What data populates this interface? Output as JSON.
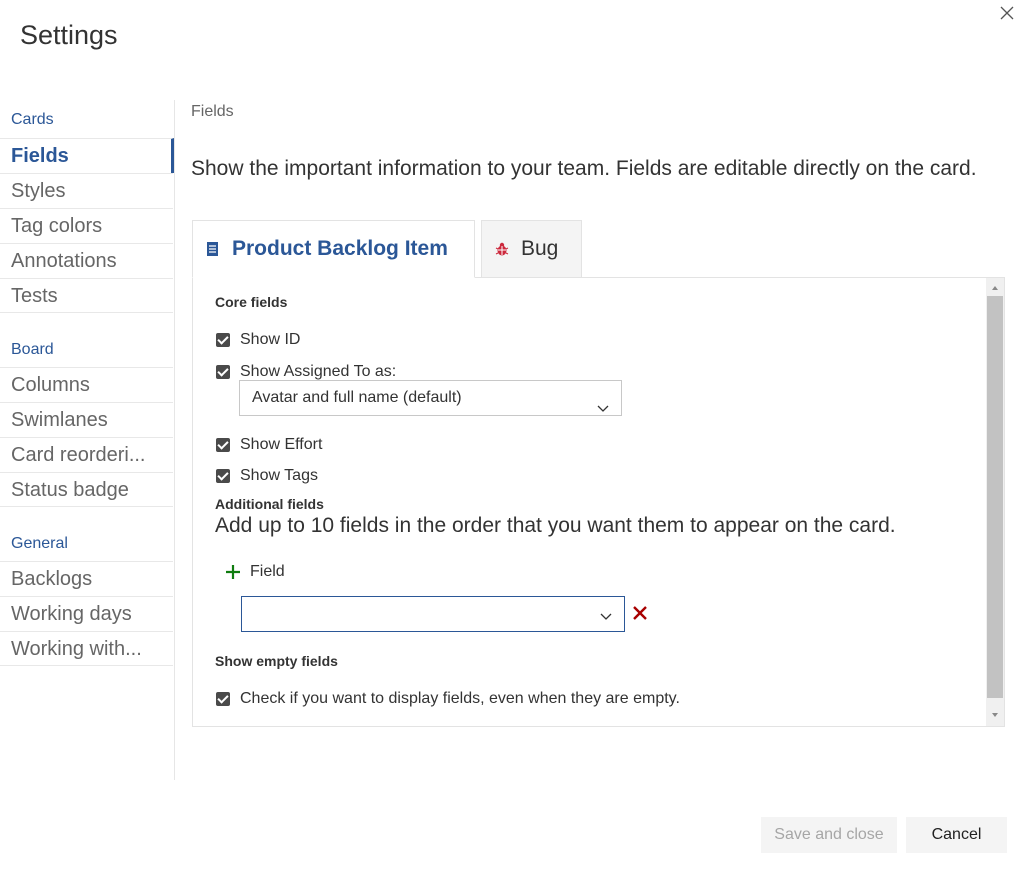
{
  "dialog": {
    "title": "Settings",
    "close_icon": "close-icon"
  },
  "sidebar": {
    "groups": [
      {
        "title": "Cards",
        "items": [
          "Fields",
          "Styles",
          "Tag colors",
          "Annotations",
          "Tests"
        ]
      },
      {
        "title": "Board",
        "items": [
          "Columns",
          "Swimlanes",
          "Card reorderi...",
          "Status badge"
        ]
      },
      {
        "title": "General",
        "items": [
          "Backlogs",
          "Working days",
          "Working with..."
        ]
      }
    ],
    "selected": "Fields"
  },
  "main": {
    "section_label": "Fields",
    "description": "Show the important information to your team. Fields are editable directly on the card.",
    "tabs": [
      {
        "label": "Product Backlog Item",
        "icon": "backlog-item-icon",
        "active": true
      },
      {
        "label": "Bug",
        "icon": "bug-icon",
        "active": false
      }
    ],
    "core_fields": {
      "title": "Core fields",
      "show_id": "Show ID",
      "show_assigned": "Show Assigned To as:",
      "assigned_select": "Avatar and full name (default)",
      "show_effort": "Show Effort",
      "show_tags": "Show Tags"
    },
    "additional_fields": {
      "title": "Additional fields",
      "description": "Add up to 10 fields in the order that you want them to appear on the card.",
      "add_label": "Field",
      "field_value": ""
    },
    "empty_fields": {
      "title": "Show empty fields",
      "checkbox_label": "Check if you want to display fields, even when they are empty."
    }
  },
  "footer": {
    "save_label": "Save and close",
    "cancel_label": "Cancel"
  },
  "colors": {
    "accent": "#2b5797",
    "add_green": "#107c10",
    "remove_red": "#a80000",
    "bug_red": "#cc293d"
  }
}
